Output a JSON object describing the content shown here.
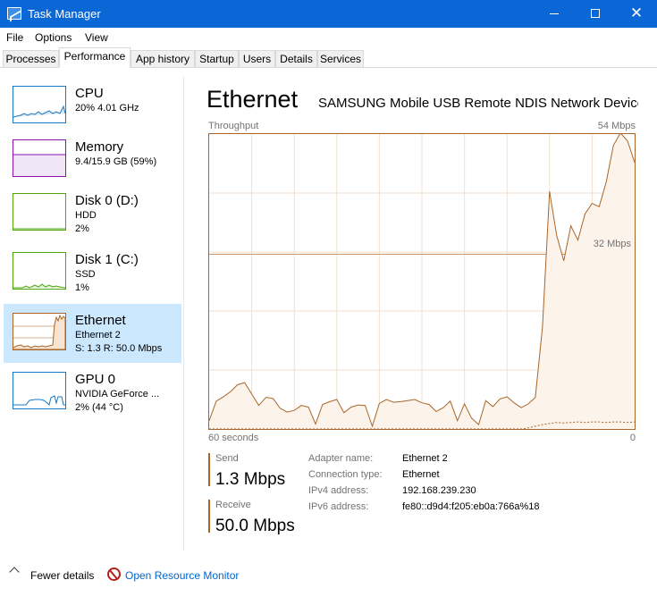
{
  "window": {
    "title": "Task Manager",
    "icon": "task-manager-icon"
  },
  "menu": [
    "File",
    "Options",
    "View"
  ],
  "tabs": [
    "Processes",
    "Performance",
    "App history",
    "Startup",
    "Users",
    "Details",
    "Services"
  ],
  "active_tab": "Performance",
  "sidebar": [
    {
      "title": "CPU",
      "line1": "20%  4.01 GHz",
      "line2": "",
      "color": "#1a79c2"
    },
    {
      "title": "Memory",
      "line1": "9.4/15.9 GB (59%)",
      "line2": "",
      "color": "#8b12ae"
    },
    {
      "title": "Disk 0 (D:)",
      "line1": "HDD",
      "line2": "2%",
      "color": "#4da60c"
    },
    {
      "title": "Disk 1 (C:)",
      "line1": "SSD",
      "line2": "1%",
      "color": "#4da60c"
    },
    {
      "title": "Ethernet",
      "line1": "Ethernet 2",
      "line2": "S: 1.3  R: 50.0 Mbps",
      "color": "#a8662a",
      "selected": true
    },
    {
      "title": "GPU 0",
      "line1": "NVIDIA GeForce ...",
      "line2": "2% (44 °C)",
      "color": "#1a79c2"
    }
  ],
  "main": {
    "title": "Ethernet",
    "adapter": "SAMSUNG Mobile USB Remote NDIS Network Device",
    "graph_label": "Throughput",
    "graph_max": "54 Mbps",
    "graph_mid": "32 Mbps",
    "x_left": "60 seconds",
    "x_right": "0",
    "line_color": "#a8662a",
    "fill_color": "#fcf3eb"
  },
  "chart_data": {
    "type": "area",
    "ylim": [
      0,
      54
    ],
    "x": [
      60,
      59,
      58,
      57,
      56,
      55,
      54,
      53,
      52,
      51,
      50,
      49,
      48,
      47,
      46,
      45,
      44,
      43,
      42,
      41,
      40,
      39,
      38,
      37,
      36,
      35,
      34,
      33,
      32,
      31,
      30,
      29,
      28,
      27,
      26,
      25,
      24,
      23,
      22,
      21,
      20,
      19,
      18,
      17,
      16,
      15,
      14,
      13,
      12,
      11,
      10,
      9,
      8,
      7,
      6,
      5,
      4,
      3,
      2,
      1,
      0
    ],
    "series": [
      {
        "values": [
          1.5,
          5.1,
          5.9,
          6.8,
          8.1,
          8.5,
          6.4,
          4.3,
          5.8,
          5.6,
          3.8,
          3.1,
          3.4,
          4.3,
          4.0,
          0.9,
          4.5,
          5.0,
          5.4,
          3.0,
          4.0,
          4.4,
          4.3,
          0.5,
          4.7,
          5.4,
          4.9,
          5.0,
          5.2,
          5.4,
          4.8,
          4.5,
          3.2,
          3.9,
          5.1,
          1.5,
          4.6,
          2.0,
          0.8,
          5.2,
          4.1,
          5.5,
          5.9,
          4.8,
          3.9,
          4.6,
          5.8,
          18.7,
          43.5,
          35.5,
          30.8,
          37.2,
          34.6,
          39.4,
          41.3,
          40.7,
          45.3,
          51.9,
          54.2,
          52.7,
          48.8
        ]
      },
      {
        "values": [
          0,
          0,
          0,
          0,
          0,
          0,
          0,
          0,
          0,
          0,
          0,
          0,
          0,
          0,
          0,
          0,
          0,
          0,
          0,
          0,
          0,
          0,
          0,
          0,
          0,
          0,
          0,
          0,
          0,
          0,
          0,
          0,
          0,
          0,
          0,
          0,
          0,
          0,
          0,
          0,
          0,
          0,
          0,
          0,
          0,
          0.2,
          0.5,
          0.8,
          1.0,
          1.2,
          1.1,
          1.2,
          1.3,
          1.2,
          1.3,
          1.3,
          1.2,
          1.3,
          1.3,
          1.2,
          1.3
        ]
      }
    ]
  },
  "stats": {
    "send_label": "Send",
    "send_value": "1.3 Mbps",
    "receive_label": "Receive",
    "receive_value": "50.0 Mbps"
  },
  "properties": [
    {
      "label": "Adapter name:",
      "value": "Ethernet 2"
    },
    {
      "label": "Connection type:",
      "value": "Ethernet"
    },
    {
      "label": "IPv4 address:",
      "value": "192.168.239.230"
    },
    {
      "label": "IPv6 address:",
      "value": "fe80::d9d4:f205:eb0a:766a%18"
    }
  ],
  "footer": {
    "fewer_details": "Fewer details",
    "resource_monitor": "Open Resource Monitor"
  }
}
